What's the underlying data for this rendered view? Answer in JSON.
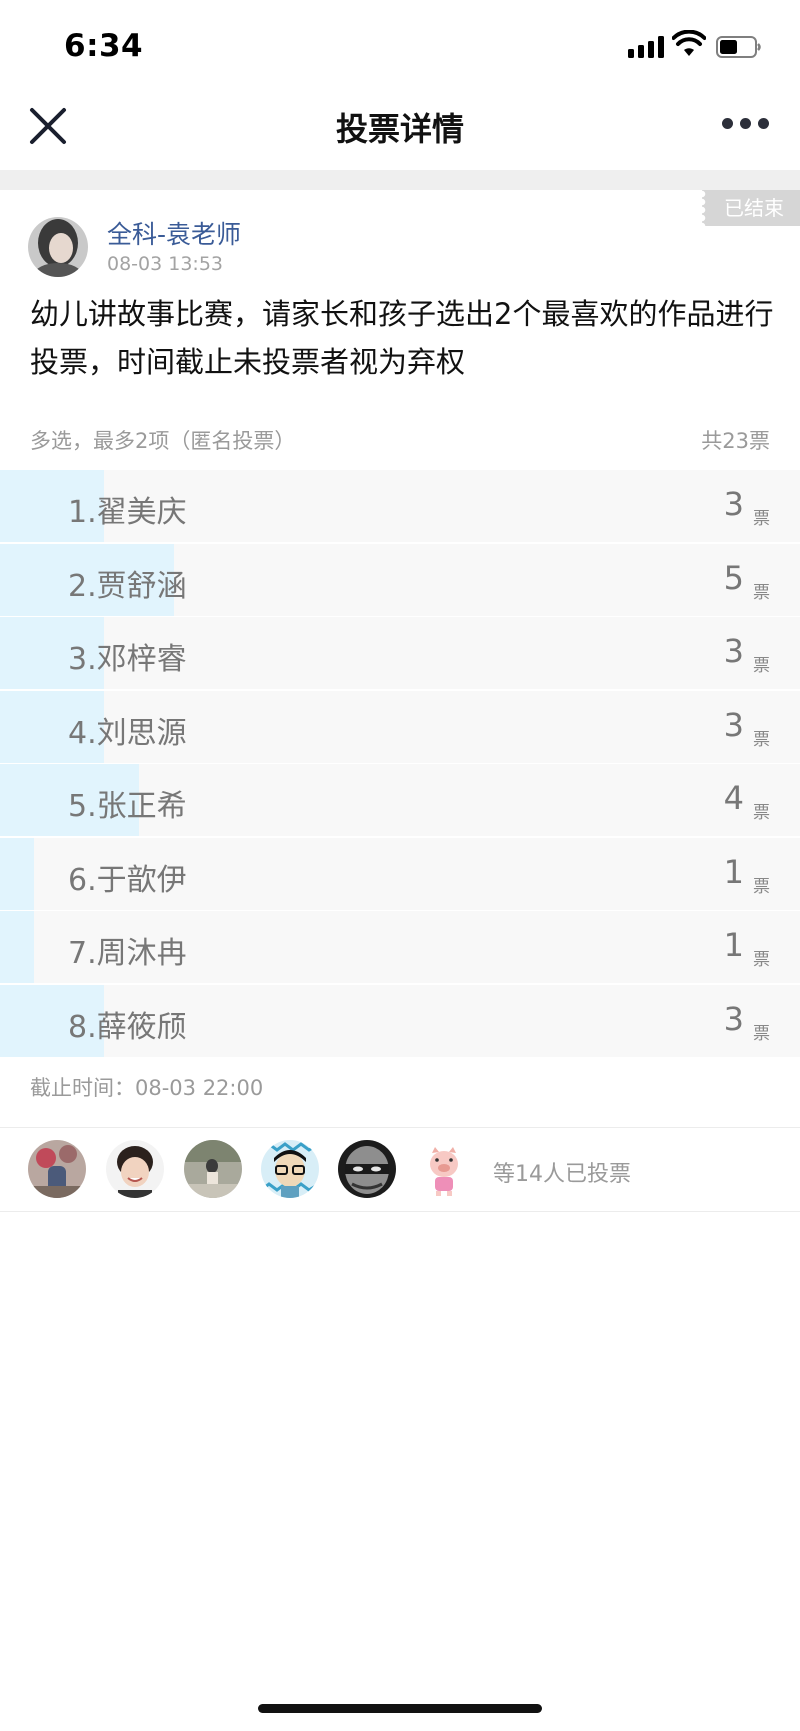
{
  "status_bar": {
    "time": "6:34"
  },
  "nav": {
    "title": "投票详情"
  },
  "post": {
    "badge": "已结束",
    "author": "全科-袁老师",
    "time": "08-03 13:53",
    "content": "幼儿讲故事比赛，请家长和孩子选出2个最喜欢的作品进行投票，时间截止未投票者视为弃权"
  },
  "vote": {
    "info": "多选，最多2项（匿名投票）",
    "total": "共23票",
    "unit": "票",
    "options": [
      {
        "label": "1.翟美庆",
        "count": "3",
        "fraction": 0.13
      },
      {
        "label": "2.贾舒涵",
        "count": "5",
        "fraction": 0.217
      },
      {
        "label": "3.邓梓睿",
        "count": "3",
        "fraction": 0.13
      },
      {
        "label": "4.刘思源",
        "count": "3",
        "fraction": 0.13
      },
      {
        "label": "5.张正希",
        "count": "4",
        "fraction": 0.174
      },
      {
        "label": "6.于歆伊",
        "count": "1",
        "fraction": 0.043
      },
      {
        "label": "7.周沐冉",
        "count": "1",
        "fraction": 0.043
      },
      {
        "label": "8.薛筱颀",
        "count": "3",
        "fraction": 0.13
      }
    ],
    "deadline": "截止时间：08-03 22:00",
    "voters_text": "等14人已投票"
  },
  "colors": {
    "fill": "#e1f4fd",
    "author": "#3a5b97",
    "muted": "#9a9a9a"
  }
}
